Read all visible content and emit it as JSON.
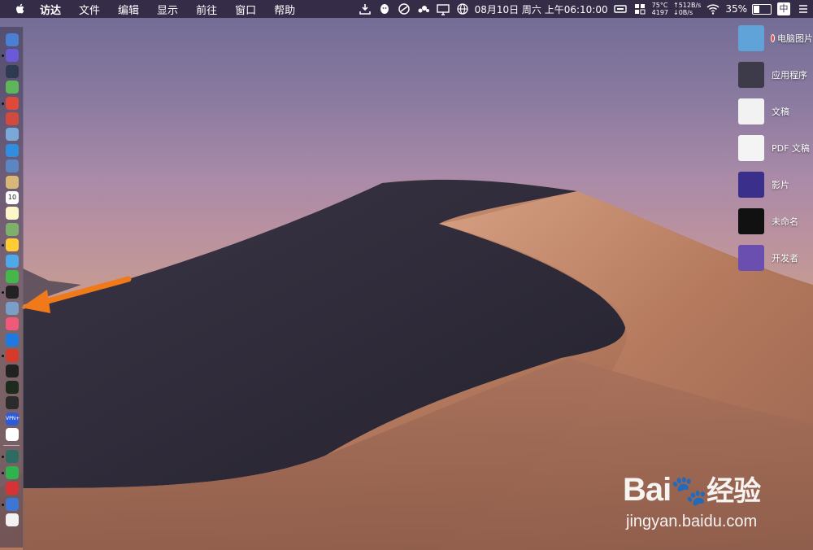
{
  "menubar": {
    "app_name": "访达",
    "menus": [
      "文件",
      "编辑",
      "显示",
      "前往",
      "窗口",
      "帮助"
    ],
    "datetime": "08月10日 周六 上午06:10:00",
    "cpu_temp": "75°C",
    "fan_rpm": "4197",
    "net_up": "↑512B/s",
    "net_down": "↓0B/s",
    "battery_percent": "35%",
    "battery_level": 0.35,
    "input_method": "中",
    "status_icons": [
      "download-icon",
      "qq-icon",
      "compass-icon",
      "clouds-icon",
      "display-icon",
      "globe-icon",
      "calendar-icon",
      "screen-icon",
      "menu-icon",
      "wifi-icon",
      "battery-icon",
      "input-method-icon"
    ]
  },
  "dock": {
    "icons": [
      "finder-icon",
      "siri-icon",
      "launchpad-icon",
      "android-icon",
      "chrome-icon",
      "tools-icon",
      "save-icon",
      "safari-icon",
      "preview-icon",
      "notes-icon",
      "calendar-icon",
      "notepad-icon",
      "maps-icon",
      "photos-icon",
      "messages-icon",
      "facetime-icon",
      "screenshot-icon",
      "keynote-icon",
      "music-icon",
      "appstore-icon",
      "vivaldi-icon",
      "terminal-icon",
      "activity-monitor-icon",
      "console-icon",
      "vpn-icon",
      "yandex-icon",
      "screenshot-tool-icon",
      "wechat-icon",
      "netease-music-icon",
      "feishu-icon",
      "textedit-icon"
    ],
    "calendar_day": "10",
    "vpn_label": "VPN+"
  },
  "desktop": {
    "items": [
      {
        "label": "电脑图片",
        "icon": "folder-icon",
        "tag": true
      },
      {
        "label": "应用程序",
        "icon": "apps-icon"
      },
      {
        "label": "文稿",
        "icon": "document-icon"
      },
      {
        "label": "PDF 文稿",
        "icon": "pdf-icon"
      },
      {
        "label": "影片",
        "icon": "movie-icon"
      },
      {
        "label": "未命名",
        "icon": "screenshot-icon"
      },
      {
        "label": "开发者",
        "icon": "developer-icon"
      }
    ]
  },
  "colors": {
    "menubar_bg": "#2a1f38",
    "arrow": "#f07a1a",
    "tag_red": "#e44f4f"
  },
  "watermark": {
    "logo": "Bai百度经验",
    "url": "jingyan.baidu.com"
  }
}
